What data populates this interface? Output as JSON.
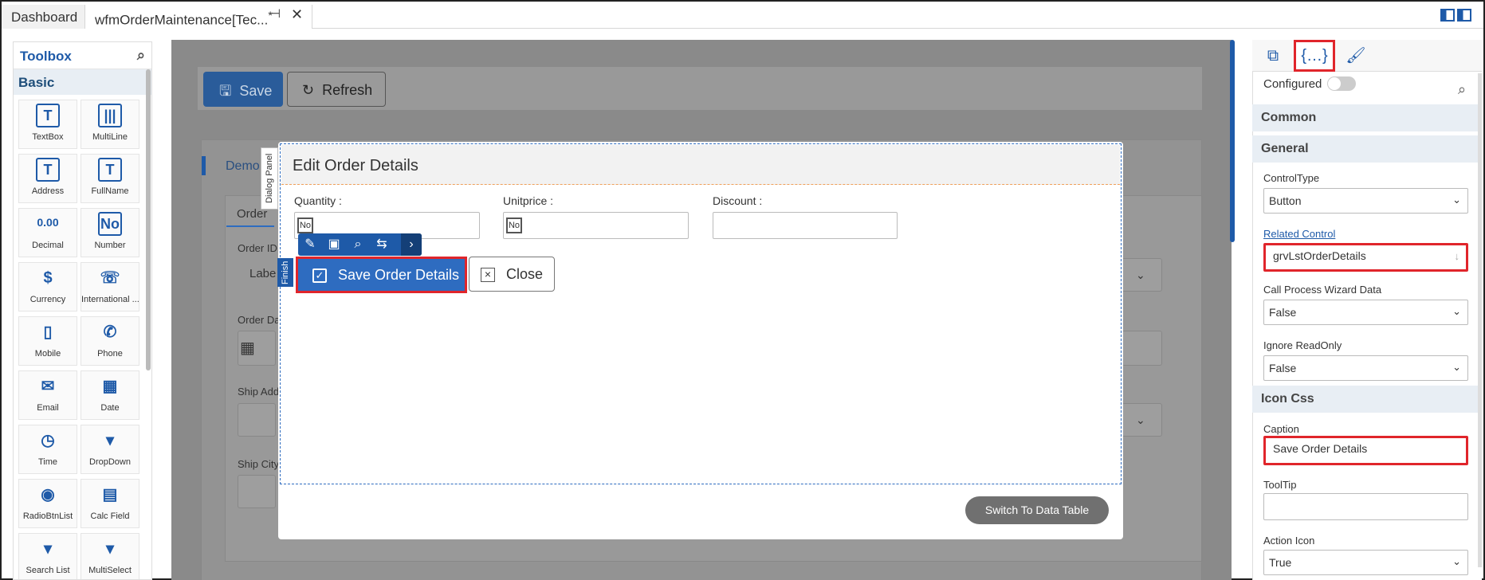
{
  "tabs": {
    "dashboard": "Dashboard",
    "active": "wfmOrderMaintenance[Tec...",
    "modified_mark": "*"
  },
  "toolbox": {
    "title": "Toolbox",
    "section": "Basic",
    "items": [
      {
        "label": "TextBox",
        "icon": "T"
      },
      {
        "label": "MultiLine",
        "icon": "|||"
      },
      {
        "label": "Address",
        "icon": "T"
      },
      {
        "label": "FullName",
        "icon": "T"
      },
      {
        "label": "Decimal",
        "icon": "0.00"
      },
      {
        "label": "Number",
        "icon": "No"
      },
      {
        "label": "Currency",
        "icon": "$"
      },
      {
        "label": "International ...",
        "icon": "☏"
      },
      {
        "label": "Mobile",
        "icon": "▯"
      },
      {
        "label": "Phone",
        "icon": "✆"
      },
      {
        "label": "Email",
        "icon": "✉"
      },
      {
        "label": "Date",
        "icon": "▦"
      },
      {
        "label": "Time",
        "icon": "◷"
      },
      {
        "label": "DropDown",
        "icon": "▾"
      },
      {
        "label": "RadioBtnList",
        "icon": "◉"
      },
      {
        "label": "Calc Field",
        "icon": "▤"
      },
      {
        "label": "Search List",
        "icon": "▾"
      },
      {
        "label": "MultiSelect",
        "icon": "▾"
      }
    ]
  },
  "canvas": {
    "save_label": "Save",
    "refresh_label": "Refresh",
    "card_title": "Demo",
    "card_tab": "Order",
    "field_order_id": "Order ID",
    "label_placeholder": "Labe",
    "field_order_date": "Order Da",
    "field_ship_address": "Ship Add",
    "field_ship_city": "Ship City"
  },
  "dialog": {
    "panel_tag": "Dialog Panel",
    "title": "Edit Order Details",
    "quantity_label": "Quantity :",
    "unitprice_label": "Unitprice :",
    "discount_label": "Discount :",
    "no_badge": "No",
    "finish_tag": "Finish",
    "save_details_label": "Save Order Details",
    "close_label": "Close",
    "switch_label": "Switch To Data Table"
  },
  "props": {
    "configured_label": "Configured",
    "section_common": "Common",
    "section_general": "General",
    "control_type_label": "ControlType",
    "control_type_value": "Button",
    "related_control_label": "Related Control",
    "related_control_value": "grvLstOrderDetails",
    "call_process_label": "Call Process Wizard Data",
    "call_process_value": "False",
    "ignore_readonly_label": "Ignore ReadOnly",
    "ignore_readonly_value": "False",
    "section_icon_css": "Icon Css",
    "caption_label": "Caption",
    "caption_value": "Save Order Details",
    "tooltip_label": "ToolTip",
    "tooltip_value": "",
    "action_icon_label": "Action Icon",
    "action_icon_value": "True"
  },
  "colors": {
    "accent": "#1e5aa8",
    "highlight": "#e0252b",
    "primary_button": "#2e6cc0"
  }
}
